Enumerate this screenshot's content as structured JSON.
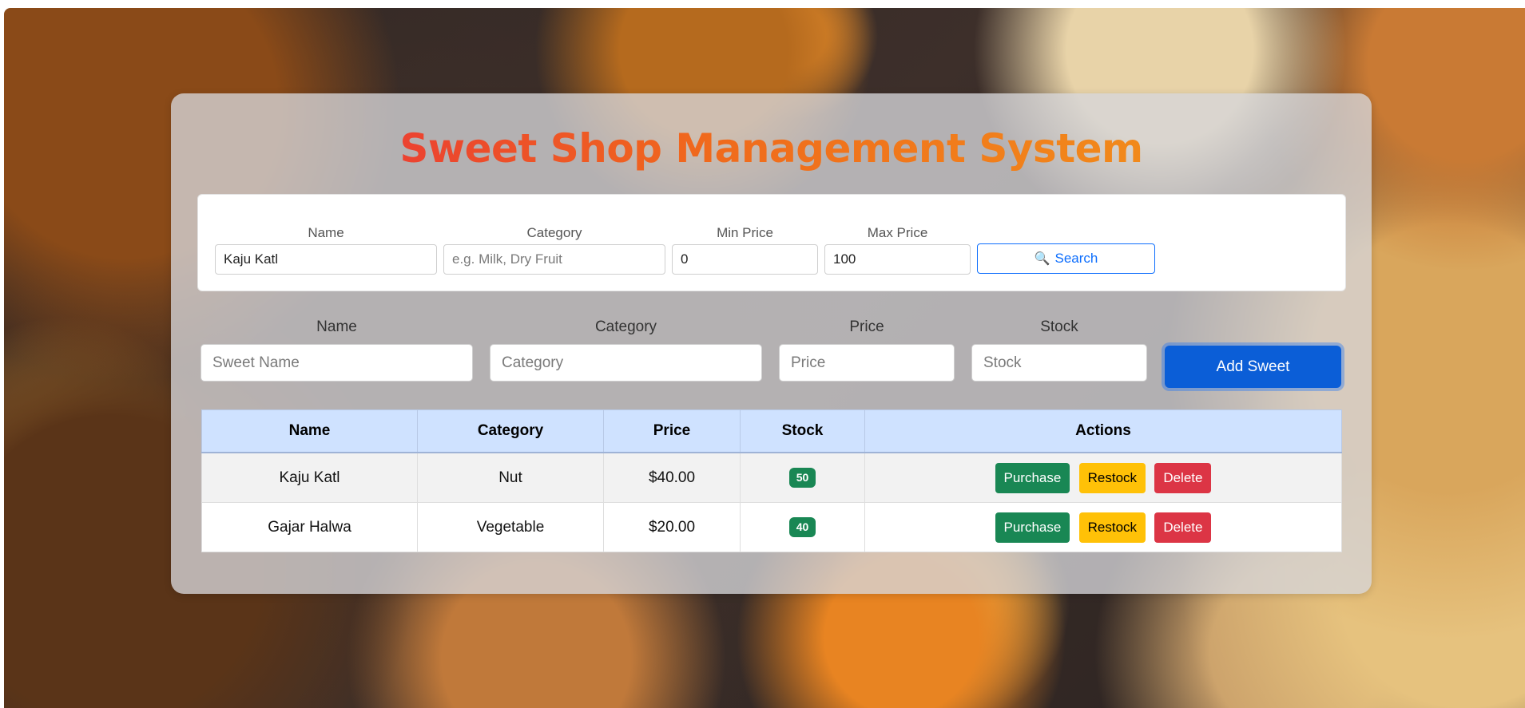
{
  "app": {
    "title": "Sweet Shop Management System",
    "title_gradient": [
      "#e8253f",
      "#f06a1c",
      "#f29a1a"
    ]
  },
  "search": {
    "name_label": "Name",
    "name_value": "Kaju Katl",
    "category_label": "Category",
    "category_placeholder": "e.g. Milk, Dry Fruit",
    "min_label": "Min Price",
    "min_value": "0",
    "max_label": "Max Price",
    "max_value": "100",
    "button_label": "Search",
    "button_icon": "magnifier-icon"
  },
  "add_form": {
    "name_label": "Name",
    "name_placeholder": "Sweet Name",
    "category_label": "Category",
    "category_placeholder": "Category",
    "price_label": "Price",
    "price_placeholder": "Price",
    "stock_label": "Stock",
    "stock_placeholder": "Stock",
    "button_label": "Add Sweet"
  },
  "table": {
    "headers": [
      "Name",
      "Category",
      "Price",
      "Stock",
      "Actions"
    ],
    "rows": [
      {
        "name": "Kaju Katl",
        "category": "Nut",
        "price": "$40.00",
        "stock": "50"
      },
      {
        "name": "Gajar Halwa",
        "category": "Vegetable",
        "price": "$20.00",
        "stock": "40"
      }
    ],
    "actions": {
      "purchase": "Purchase",
      "restock": "Restock",
      "delete": "Delete"
    }
  },
  "colors": {
    "primary": "#0b5ed7",
    "success": "#198754",
    "warning": "#ffc107",
    "danger": "#dc3545",
    "table_header": "#cfe2ff"
  }
}
